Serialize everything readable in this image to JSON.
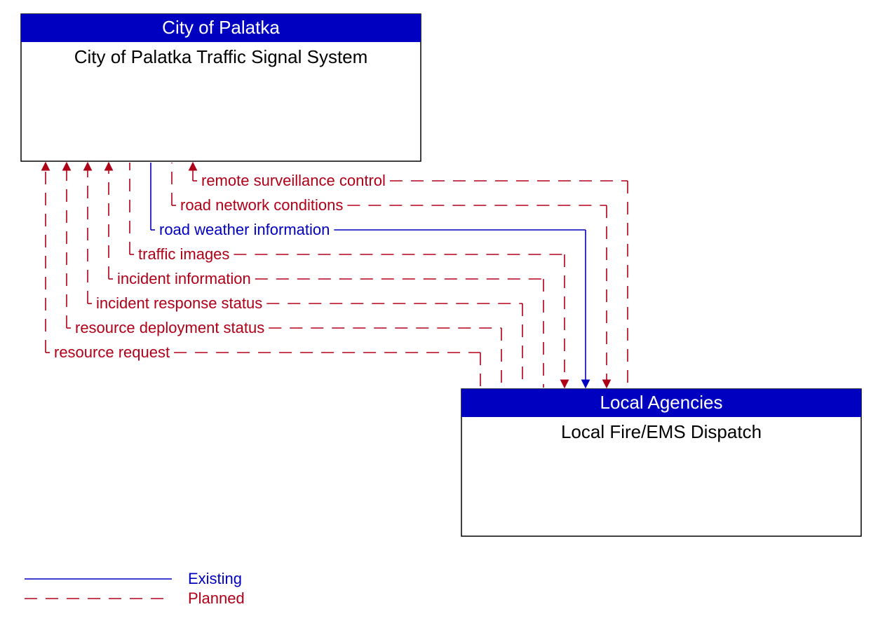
{
  "colors": {
    "header_bg": "#0000c0",
    "existing": "#0000c0",
    "planned": "#b00018"
  },
  "boxA": {
    "header": "City of Palatka",
    "body": "City of Palatka Traffic Signal System"
  },
  "boxB": {
    "header": "Local Agencies",
    "body": "Local Fire/EMS Dispatch"
  },
  "flows": [
    {
      "label": "remote surveillance control",
      "status": "planned",
      "direction": "toA"
    },
    {
      "label": "road network conditions",
      "status": "planned",
      "direction": "toB"
    },
    {
      "label": "road weather information",
      "status": "existing",
      "direction": "toB"
    },
    {
      "label": "traffic images",
      "status": "planned",
      "direction": "toB"
    },
    {
      "label": "incident information",
      "status": "planned",
      "direction": "toA"
    },
    {
      "label": "incident response status",
      "status": "planned",
      "direction": "toA"
    },
    {
      "label": "resource deployment status",
      "status": "planned",
      "direction": "toA"
    },
    {
      "label": "resource request",
      "status": "planned",
      "direction": "toA"
    }
  ],
  "legend": {
    "existing": "Existing",
    "planned": "Planned"
  }
}
